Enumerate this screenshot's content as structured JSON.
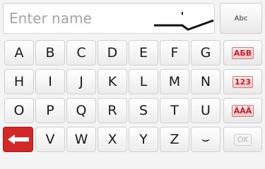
{
  "name_field": {
    "placeholder": "Enter name",
    "value": ""
  },
  "keyboard": {
    "row1": [
      "A",
      "B",
      "C",
      "D",
      "E",
      "F",
      "G"
    ],
    "row2": [
      "H",
      "I",
      "J",
      "K",
      "L",
      "M",
      "N"
    ],
    "row3": [
      "O",
      "P",
      "Q",
      "R",
      "S",
      "T",
      "U"
    ],
    "row4": [
      "V",
      "W",
      "X",
      "Y",
      "Z"
    ],
    "space_symbol": "⌣"
  },
  "side_keys": {
    "abc_label": "Abc",
    "letters_mode_label": "АБВ",
    "numbers_mode_label": "123",
    "accents_mode_label": "ÄÀÄ",
    "ok_label": "OK"
  },
  "colors": {
    "backspace": "#d32828",
    "mode_badge_text": "#c8202a",
    "background": "#f4f4f4"
  },
  "icons": {
    "backspace": "backspace-arrow-icon",
    "cursor": "text-cursor-icon"
  }
}
